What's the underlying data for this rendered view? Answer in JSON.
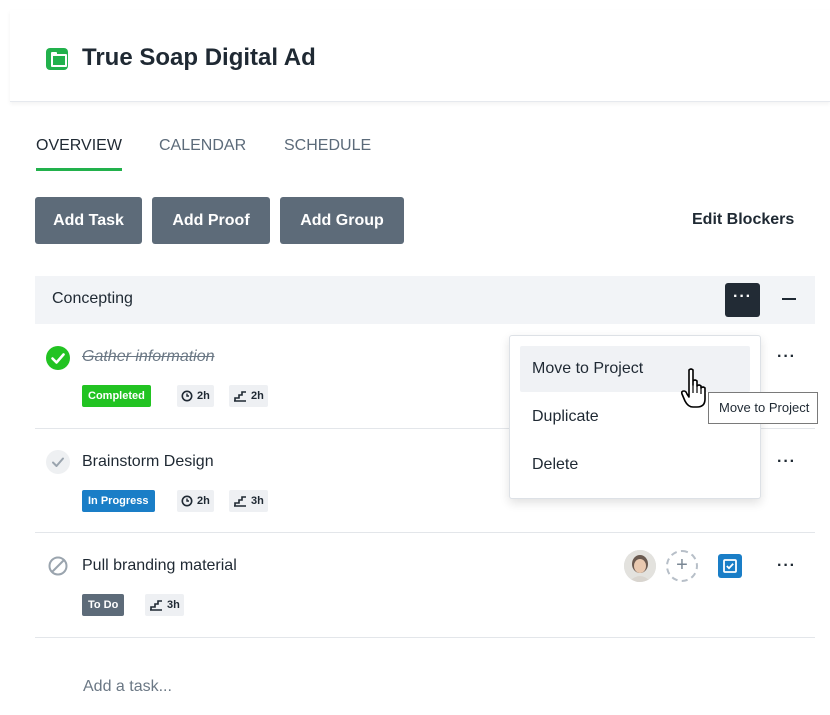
{
  "project": {
    "title": "True Soap Digital Ad"
  },
  "tabs": [
    {
      "label": "OVERVIEW",
      "active": true
    },
    {
      "label": "CALENDAR",
      "active": false
    },
    {
      "label": "SCHEDULE",
      "active": false
    }
  ],
  "toolbar": {
    "add_task": "Add Task",
    "add_proof": "Add Proof",
    "add_group": "Add Group",
    "edit_blockers": "Edit Blockers"
  },
  "group": {
    "label": "Concepting",
    "more_label": "···"
  },
  "tasks": [
    {
      "name": "Gather information",
      "status": "Completed",
      "status_color": "#22c322",
      "time_estimate": "2h",
      "time_tracked": "2h"
    },
    {
      "name": "Brainstorm Design",
      "status": "In Progress",
      "status_color": "#1a7ec7",
      "time_estimate": "2h",
      "time_tracked": "3h"
    },
    {
      "name": "Pull branding material",
      "status": "To Do",
      "status_color": "#5d6b79",
      "time_tracked": "3h"
    }
  ],
  "row_more_label": "···",
  "add_task_placeholder": "Add a task...",
  "context_menu": {
    "items": [
      "Move to Project",
      "Duplicate",
      "Delete"
    ]
  },
  "tooltip": "Move to Project",
  "colors": {
    "accent_green": "#22b14c",
    "button_gray": "#5d6b79",
    "dark": "#222b35"
  }
}
